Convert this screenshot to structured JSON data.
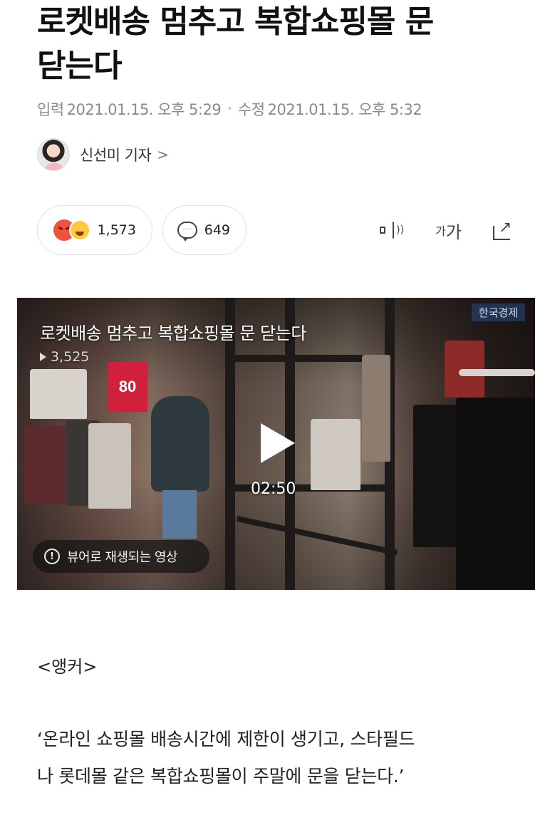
{
  "article": {
    "headline_line1": "로켓배송 멈추고 복합쇼핑몰 문",
    "headline_line2": "닫는다",
    "published_label": "입력",
    "published_time": "2021.01.15. 오후 5:29",
    "modified_label": "수정",
    "modified_time": "2021.01.15. 오후 5:32",
    "author": "신선미 기자",
    "author_arrow": ">"
  },
  "actions": {
    "reactions_count": "1,573",
    "comments_count": "649",
    "comment_icon_dots": "···",
    "fontsize_small": "가",
    "fontsize_large": "가"
  },
  "video": {
    "title": "로켓배송 멈추고 복합쇼핑몰 문 닫는다",
    "views": "3,525",
    "duration": "02:50",
    "autoplay_notice": "뷰어로 재생되는 영상",
    "channel": "한국경제",
    "sign_text": "80"
  },
  "body": {
    "anchor_label": "<앵커>",
    "paragraph_line1": "‘온라인 쇼핑몰 배송시간에 제한이 생기고, 스타필드",
    "paragraph_line2": "나 롯데몰 같은 복합쇼핑몰이 주말에 문을 닫는다.’"
  },
  "icons": [
    "angry-emoji-icon",
    "laugh-emoji-icon",
    "comment-bubble-icon",
    "speaker-icon",
    "font-size-icon",
    "share-icon",
    "play-icon",
    "info-icon"
  ]
}
